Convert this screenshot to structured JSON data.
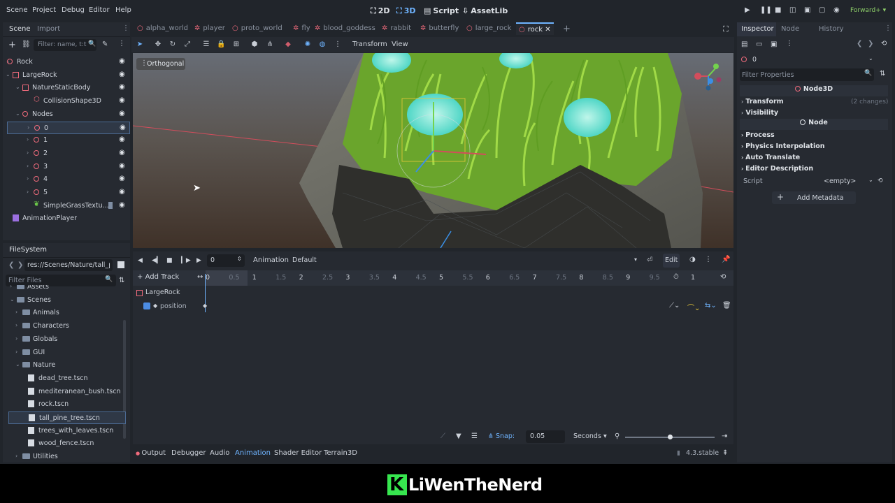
{
  "menubar": {
    "items": [
      "Scene",
      "Project",
      "Debug",
      "Editor",
      "Help"
    ],
    "workspaces": [
      "2D",
      "3D",
      "Script",
      "AssetLib"
    ],
    "active_workspace": "3D",
    "renderer": "Forward+"
  },
  "scene_dock": {
    "tabs": [
      "Scene",
      "Import"
    ],
    "filter_placeholder": "Filter: name, t:t",
    "nodes": [
      {
        "label": "Rock",
        "depth": 0
      },
      {
        "label": "LargeRock",
        "depth": 1
      },
      {
        "label": "NatureStaticBody",
        "depth": 2
      },
      {
        "label": "CollisionShape3D",
        "depth": 3
      },
      {
        "label": "Nodes",
        "depth": 2
      },
      {
        "label": "0",
        "depth": 3,
        "selected": true
      },
      {
        "label": "1",
        "depth": 3
      },
      {
        "label": "2",
        "depth": 3
      },
      {
        "label": "3",
        "depth": 3
      },
      {
        "label": "4",
        "depth": 3
      },
      {
        "label": "5",
        "depth": 3
      },
      {
        "label": "SimpleGrassTextu...",
        "depth": 2
      },
      {
        "label": "AnimationPlayer",
        "depth": 1
      }
    ]
  },
  "filesystem": {
    "title": "FileSystem",
    "path": "res://Scenes/Nature/tall_pi",
    "filter_placeholder": "Filter Files",
    "items": [
      {
        "label": "Assets",
        "type": "folder",
        "depth": 1
      },
      {
        "label": "Scenes",
        "type": "folder",
        "depth": 1
      },
      {
        "label": "Animals",
        "type": "folder",
        "depth": 2
      },
      {
        "label": "Characters",
        "type": "folder",
        "depth": 2
      },
      {
        "label": "Globals",
        "type": "folder",
        "depth": 2
      },
      {
        "label": "GUI",
        "type": "folder",
        "depth": 2
      },
      {
        "label": "Nature",
        "type": "folder",
        "depth": 2
      },
      {
        "label": "dead_tree.tscn",
        "type": "file",
        "depth": 3
      },
      {
        "label": "mediteranean_bush.tscn",
        "type": "file",
        "depth": 3
      },
      {
        "label": "rock.tscn",
        "type": "file",
        "depth": 3
      },
      {
        "label": "tall_pine_tree.tscn",
        "type": "file",
        "depth": 3,
        "selected": true
      },
      {
        "label": "trees_with_leaves.tscn",
        "type": "file",
        "depth": 3
      },
      {
        "label": "wood_fence.tscn",
        "type": "file",
        "depth": 3
      },
      {
        "label": "Utilities",
        "type": "folder",
        "depth": 2
      }
    ]
  },
  "scene_tabs": [
    "alpha_world",
    "player",
    "proto_world",
    "fly",
    "blood_goddess",
    "rabbit",
    "butterfly",
    "large_rock",
    "rock"
  ],
  "active_scene_tab": "rock",
  "viewport": {
    "menus": [
      "Transform",
      "View"
    ],
    "view_label": "Orthogonal"
  },
  "animation": {
    "frame_value": "0",
    "animation_label": "Animation",
    "animation_name": "Default",
    "edit_label": "Edit",
    "add_track_label": "Add Track",
    "ticks": [
      "0",
      "0.5",
      "1",
      "1.5",
      "2",
      "2.5",
      "3",
      "3.5",
      "4",
      "4.5",
      "5",
      "5.5",
      "6",
      "6.5",
      "7",
      "7.5",
      "8",
      "8.5",
      "9",
      "9.5"
    ],
    "length_value": "1",
    "track_node": "LargeRock",
    "track_property": "position",
    "snap_label": "Snap:",
    "snap_value": "0.05",
    "unit": "Seconds"
  },
  "bottom_tabs": [
    "Output",
    "Debugger",
    "Audio",
    "Animation",
    "Shader Editor",
    "Terrain3D"
  ],
  "active_bottom_tab": "Animation",
  "version": "4.3.stable",
  "inspector": {
    "tabs": [
      "Inspector",
      "Node",
      "History"
    ],
    "object_name": "0",
    "filter_placeholder": "Filter Properties",
    "class_header": "Node3D",
    "sections": [
      {
        "label": "Transform",
        "note": "(2 changes)"
      },
      {
        "label": "Visibility",
        "note": ""
      }
    ],
    "node_header": "Node",
    "node_sections": [
      "Process",
      "Physics Interpolation",
      "Auto Translate",
      "Editor Description"
    ],
    "script_label": "Script",
    "script_value": "<empty>",
    "add_metadata_label": "Add Metadata"
  },
  "watermark": "LiWenTheNerd"
}
